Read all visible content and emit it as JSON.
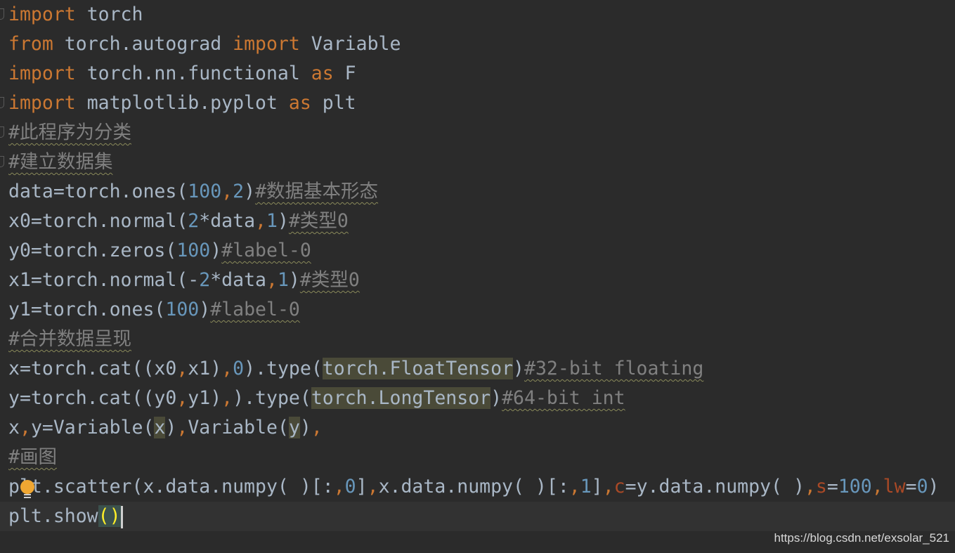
{
  "editor": {
    "current_line": 17,
    "colors": {
      "background": "#2b2b2b",
      "keyword": "#cc7832",
      "number": "#6897bb",
      "comment": "#808080",
      "text": "#a9b7c6",
      "param": "#aa4926"
    },
    "lines": [
      {
        "fold": true,
        "tokens": [
          [
            "import",
            "kw"
          ],
          [
            " torch",
            ""
          ]
        ]
      },
      {
        "tokens": [
          [
            "from",
            "kw"
          ],
          [
            " torch.autograd ",
            ""
          ],
          [
            "import",
            "kw"
          ],
          [
            " Variable",
            ""
          ]
        ]
      },
      {
        "tokens": [
          [
            "import",
            "kw"
          ],
          [
            " torch.nn.functional ",
            ""
          ],
          [
            "as",
            "kw"
          ],
          [
            " F",
            ""
          ]
        ]
      },
      {
        "fold": true,
        "tokens": [
          [
            "import",
            "kw"
          ],
          [
            " matplotlib.pyplot ",
            ""
          ],
          [
            "as",
            "kw"
          ],
          [
            " plt",
            ""
          ]
        ]
      },
      {
        "fold": true,
        "tokens": [
          [
            "#此程序为分类",
            "cm"
          ]
        ]
      },
      {
        "fold": true,
        "tokens": [
          [
            "#建立数据集",
            "cm"
          ]
        ]
      },
      {
        "tokens": [
          [
            "data=torch.ones(",
            ""
          ],
          [
            "100",
            "num"
          ],
          [
            ",",
            "comma"
          ],
          [
            "2",
            "num"
          ],
          [
            ")",
            ""
          ],
          [
            "#数据基本形态",
            "cm"
          ]
        ]
      },
      {
        "tokens": [
          [
            "x0=torch.normal(",
            ""
          ],
          [
            "2",
            "num"
          ],
          [
            "*data",
            ""
          ],
          [
            ",",
            "comma"
          ],
          [
            "1",
            "num"
          ],
          [
            ")",
            ""
          ],
          [
            "#类型0",
            "cm"
          ]
        ]
      },
      {
        "tokens": [
          [
            "y0=torch.zeros(",
            ""
          ],
          [
            "100",
            "num"
          ],
          [
            ")",
            ""
          ],
          [
            "#label-0",
            "cm"
          ]
        ]
      },
      {
        "tokens": [
          [
            "x1=torch.normal(-",
            ""
          ],
          [
            "2",
            "num"
          ],
          [
            "*data",
            ""
          ],
          [
            ",",
            "comma"
          ],
          [
            "1",
            "num"
          ],
          [
            ")",
            ""
          ],
          [
            "#类型0",
            "cm"
          ]
        ]
      },
      {
        "tokens": [
          [
            "y1=torch.ones(",
            ""
          ],
          [
            "100",
            "num"
          ],
          [
            ")",
            ""
          ],
          [
            "#label-0",
            "cm"
          ]
        ]
      },
      {
        "tokens": [
          [
            "#合并数据呈现",
            "cm"
          ]
        ]
      },
      {
        "tokens": [
          [
            "x=torch.cat((x0",
            ""
          ],
          [
            ",",
            "comma"
          ],
          [
            "x1)",
            ""
          ],
          [
            ",",
            "comma"
          ],
          [
            "0",
            "num"
          ],
          [
            ").type(",
            ""
          ],
          [
            "torch.FloatTensor",
            "hl"
          ],
          [
            ")",
            ""
          ],
          [
            "#32-bit floating",
            "cm"
          ]
        ]
      },
      {
        "tokens": [
          [
            "y=torch.cat((y0",
            ""
          ],
          [
            ",",
            "comma"
          ],
          [
            "y1)",
            ""
          ],
          [
            ",",
            "comma"
          ],
          [
            ").type(",
            ""
          ],
          [
            "torch.LongTensor",
            "hl"
          ],
          [
            ")",
            ""
          ],
          [
            "#64-bit int",
            "cm"
          ]
        ]
      },
      {
        "tokens": [
          [
            "x",
            ""
          ],
          [
            ",",
            "comma"
          ],
          [
            "y=Variable(",
            ""
          ],
          [
            "x",
            "hl"
          ],
          [
            ")",
            ""
          ],
          [
            ",",
            "comma"
          ],
          [
            "Variable(",
            ""
          ],
          [
            "y",
            "hl"
          ],
          [
            ")",
            ""
          ],
          [
            ",",
            "comma"
          ]
        ]
      },
      {
        "tokens": [
          [
            "#画图",
            "cm"
          ]
        ]
      },
      {
        "tokens": [
          [
            "plt.scatter(x.data.numpy( )[:",
            ""
          ],
          [
            ",",
            "comma"
          ],
          [
            "0",
            "num"
          ],
          [
            "]",
            ""
          ],
          [
            ",",
            "comma"
          ],
          [
            "x.data.numpy( )[:",
            ""
          ],
          [
            ",",
            "comma"
          ],
          [
            "1",
            "num"
          ],
          [
            "]",
            ""
          ],
          [
            ",",
            "comma"
          ],
          [
            "c",
            "param"
          ],
          [
            "=y.data.numpy( )",
            ""
          ],
          [
            ",",
            "comma"
          ],
          [
            "s",
            "param"
          ],
          [
            "=",
            ""
          ],
          [
            "100",
            "num"
          ],
          [
            ",",
            "comma"
          ],
          [
            "lw",
            "param"
          ],
          [
            "=",
            ""
          ],
          [
            "0",
            "num"
          ],
          [
            ")",
            ""
          ]
        ]
      },
      {
        "tokens": [
          [
            "plt.show",
            ""
          ],
          [
            "()",
            "brace"
          ]
        ]
      }
    ]
  },
  "watermark": "https://blog.csdn.net/exsolar_521"
}
